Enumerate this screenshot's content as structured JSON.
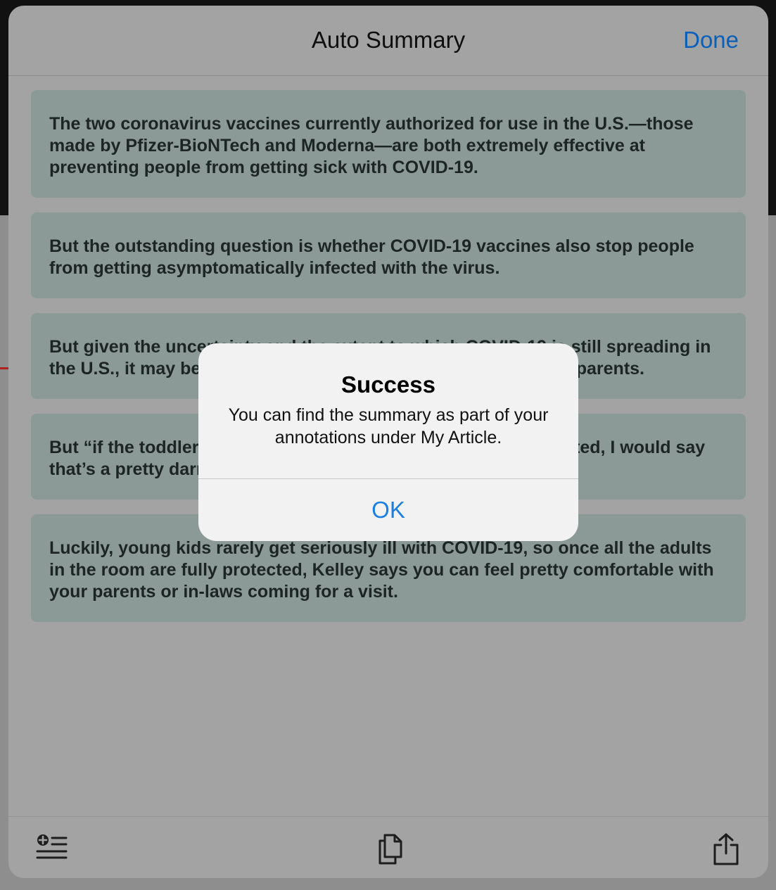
{
  "sheet": {
    "title": "Auto Summary",
    "done_label": "Done"
  },
  "summary": {
    "items": [
      "The two coronavirus vaccines currently authorized for use in the U.S.—those made by Pfizer-BioNTech and Moderna—are both extremely effective at preventing people from getting sick with COVID-19.",
      "But the outstanding question is whether COVID-19 vaccines also stop people from getting asymptomatically infected with the virus.",
      "But given the uncertainty and the extent to which COVID-19 is still spreading in the U.S., it may be wise to wait a while longer to visit with your parents.",
      "But “if the toddler is in a household where everyone is vaccinated, I would say that’s a pretty darn safe situation.”",
      "Luckily, young kids rarely get seriously ill with COVID-19, so once all the adults in the room are fully protected, Kelley says you can feel pretty comfortable with your parents or in-laws coming for a visit."
    ]
  },
  "toolbar": {
    "icons": [
      "add-to-list-icon",
      "copy-icon",
      "share-icon"
    ]
  },
  "alert": {
    "title": "Success",
    "message": "You can find the summary as part of your annotations under My Article.",
    "ok_label": "OK"
  },
  "colors": {
    "accent": "#1b7fe3",
    "done": "#0a5fb8",
    "card": "#8b9a96"
  }
}
